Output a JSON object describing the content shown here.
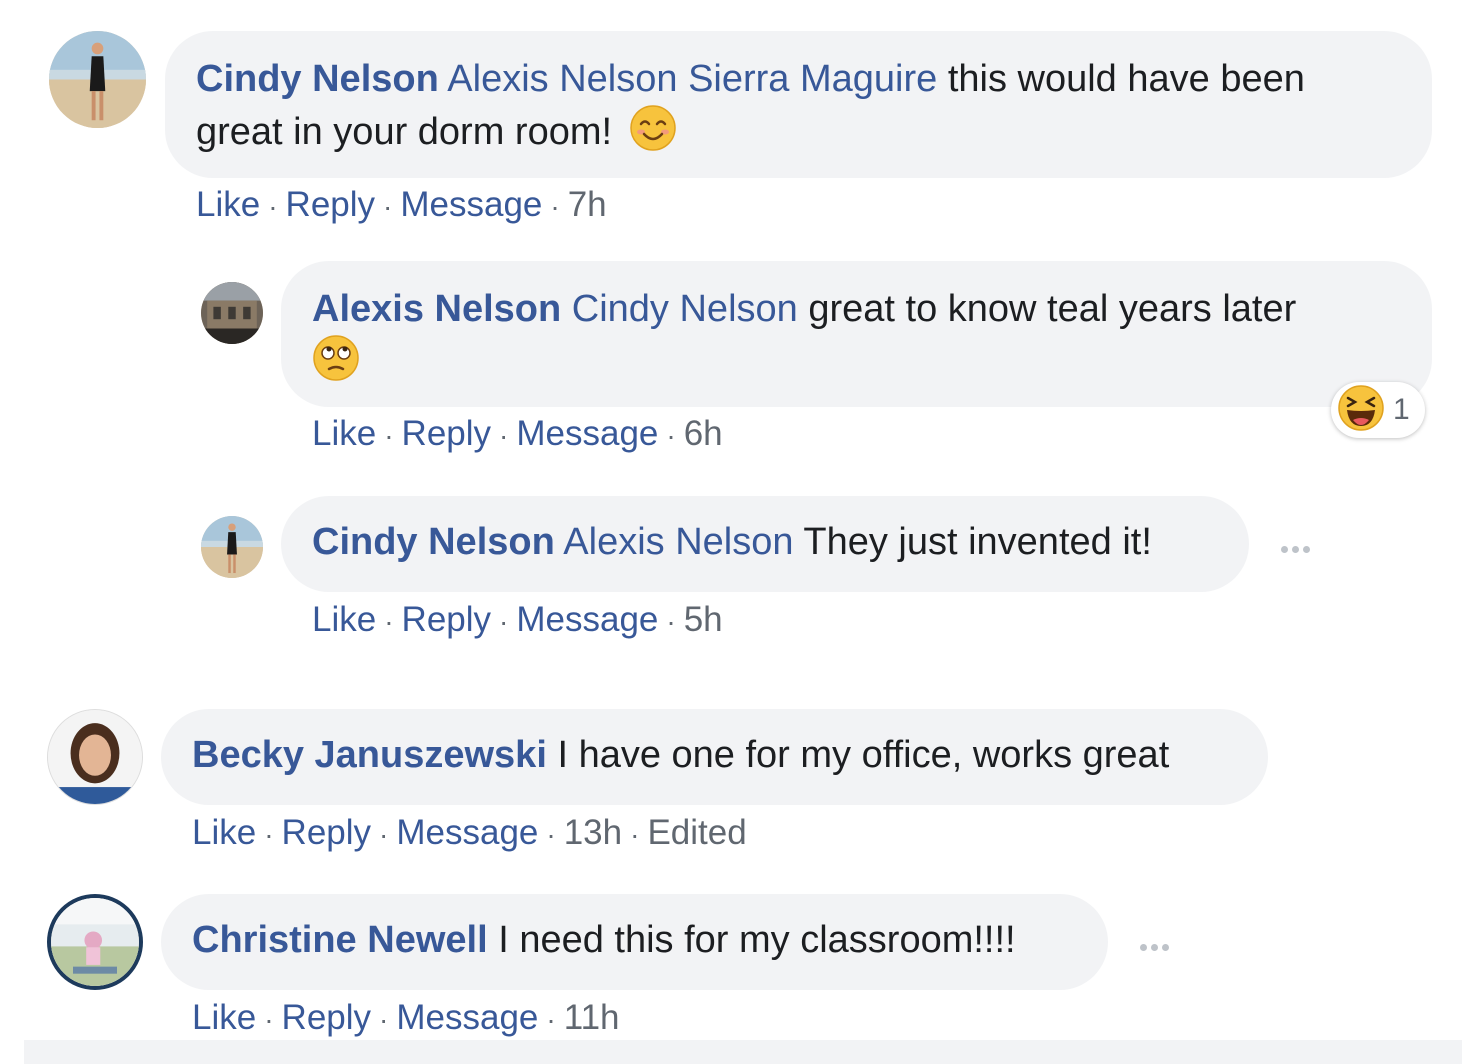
{
  "actions": {
    "like": "Like",
    "reply": "Reply",
    "message": "Message",
    "sep": "·"
  },
  "comments": [
    {
      "author": "Cindy Nelson",
      "mentions": [
        "Alexis Nelson",
        "Sierra Maguire"
      ],
      "text_line1": " this would have been",
      "text_line2": "great in your dorm room!",
      "emoji": "smiling-face-emoji",
      "time": "7h",
      "avatar": "beach-photo"
    },
    {
      "author": "Alexis Nelson",
      "mentions": [
        "Cindy Nelson"
      ],
      "text": " great to know teal years later",
      "emoji": "eye-roll-emoji",
      "time": "6h",
      "reaction": {
        "icon": "haha-reaction-icon",
        "count": "1"
      },
      "avatar": "building-photo"
    },
    {
      "author": "Cindy Nelson",
      "mentions": [
        "Alexis Nelson"
      ],
      "text": " They just invented it!",
      "time": "5h",
      "avatar": "beach-photo"
    },
    {
      "author": "Becky Januszewski",
      "text": " I have one for my office, works great",
      "time": "13h",
      "edited": "Edited",
      "avatar": "portrait-photo"
    },
    {
      "author": "Christine Newell",
      "text": " I need this for my classroom!!!!",
      "time": "11h",
      "avatar": "badge-photo"
    }
  ],
  "colors": {
    "link": "#385898",
    "bubble": "#f2f3f5",
    "meta": "#606770"
  }
}
